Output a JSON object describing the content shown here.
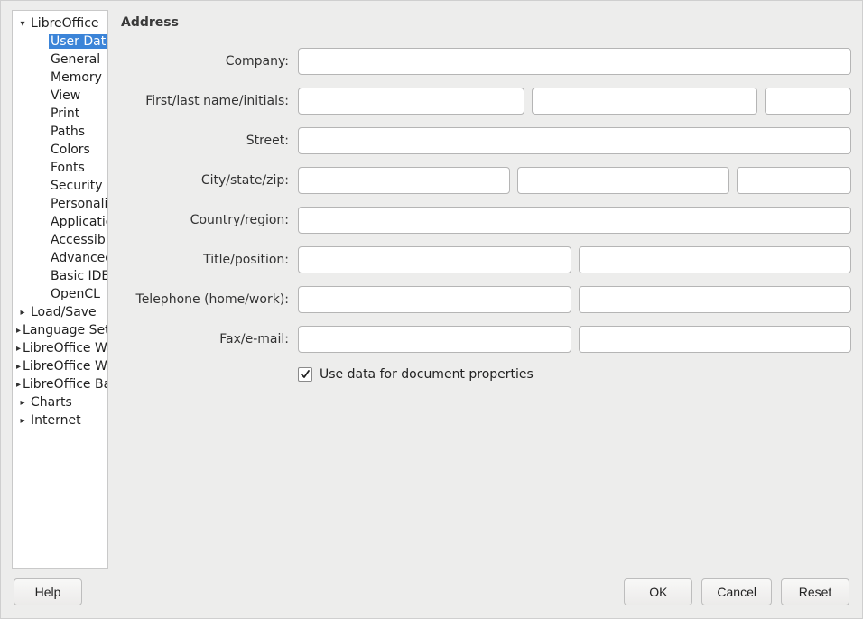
{
  "tree": {
    "libreoffice": {
      "label": "LibreOffice",
      "expanded": true
    },
    "children": [
      {
        "label": "User Data",
        "selected": true
      },
      {
        "label": "General"
      },
      {
        "label": "Memory"
      },
      {
        "label": "View"
      },
      {
        "label": "Print"
      },
      {
        "label": "Paths"
      },
      {
        "label": "Colors"
      },
      {
        "label": "Fonts"
      },
      {
        "label": "Security"
      },
      {
        "label": "Personalization"
      },
      {
        "label": "Application Colors"
      },
      {
        "label": "Accessibility"
      },
      {
        "label": "Advanced"
      },
      {
        "label": "Basic IDE Options"
      },
      {
        "label": "OpenCL"
      }
    ],
    "siblings": [
      {
        "label": "Load/Save"
      },
      {
        "label": "Language Settings"
      },
      {
        "label": "LibreOffice Writer"
      },
      {
        "label": "LibreOffice Writer/Web"
      },
      {
        "label": "LibreOffice Base"
      },
      {
        "label": "Charts"
      },
      {
        "label": "Internet"
      }
    ]
  },
  "section": {
    "title": "Address"
  },
  "labels": {
    "company": "Company:",
    "name": "First/last name/initials:",
    "street": "Street:",
    "city": "City/state/zip:",
    "country": "Country/region:",
    "title": "Title/position:",
    "phone": "Telephone (home/work):",
    "fax": "Fax/e-mail:"
  },
  "values": {
    "company": "",
    "first": "",
    "last": "",
    "initials": "",
    "street": "",
    "city": "",
    "state": "",
    "zip": "",
    "country": "",
    "title": "",
    "position": "",
    "phone_home": "",
    "phone_work": "",
    "fax": "",
    "email": ""
  },
  "checkbox": {
    "use_data_label": "Use data for document properties",
    "checked": true
  },
  "buttons": {
    "help": "Help",
    "ok": "OK",
    "cancel": "Cancel",
    "reset": "Reset"
  }
}
